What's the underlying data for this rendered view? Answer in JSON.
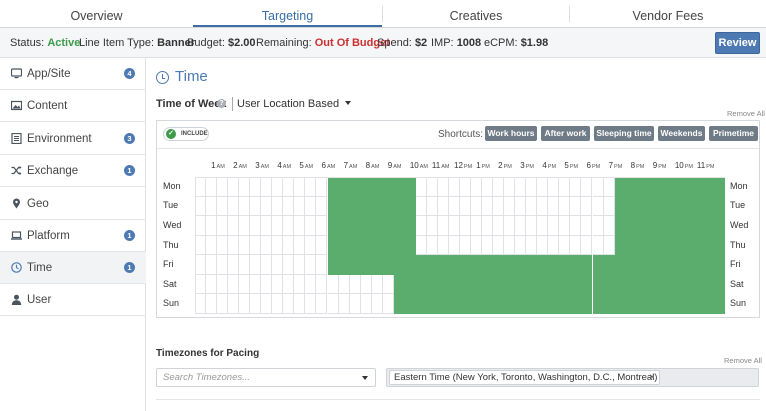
{
  "tabs": [
    {
      "label": "Overview",
      "active": false
    },
    {
      "label": "Targeting",
      "active": true
    },
    {
      "label": "Creatives",
      "active": false
    },
    {
      "label": "Vendor Fees",
      "active": false
    }
  ],
  "status": {
    "status_label": "Status:",
    "status_value": "Active",
    "type_label": "Line Item Type:",
    "type_value": "Banner",
    "budget_label": "Budget:",
    "budget_value": "$2.00",
    "remaining_label": "Remaining:",
    "remaining_value": "Out Of Budget",
    "spend_label": "Spend:",
    "spend_value": "$2",
    "imp_label": "IMP:",
    "imp_value": "1008",
    "ecpm_label": "eCPM:",
    "ecpm_value": "$1.98",
    "review_label": "Review",
    "colors": {
      "active": "#3c9a4a",
      "out_of_budget": "#cc2f2f",
      "accent": "#4d7ab2"
    }
  },
  "sidebar": {
    "items": [
      {
        "label": "App/Site",
        "badge": "4",
        "icon": "device-icon",
        "active": false
      },
      {
        "label": "Content",
        "badge": "",
        "icon": "image-icon",
        "active": false
      },
      {
        "label": "Environment",
        "badge": "3",
        "icon": "document-icon",
        "active": false
      },
      {
        "label": "Exchange",
        "badge": "1",
        "icon": "shuffle-icon",
        "active": false
      },
      {
        "label": "Geo",
        "badge": "",
        "icon": "map-pin-icon",
        "active": false
      },
      {
        "label": "Platform",
        "badge": "1",
        "icon": "laptop-icon",
        "active": false
      },
      {
        "label": "Time",
        "badge": "1",
        "icon": "clock-icon",
        "active": true
      },
      {
        "label": "User",
        "badge": "",
        "icon": "user-icon",
        "active": false
      }
    ]
  },
  "main": {
    "title": "Time",
    "time_of_week_label": "Time of Week",
    "targeting_mode": "User Location Based",
    "remove_all": "Remove All",
    "include_label": "INCLUDE",
    "shortcuts_label": "Shortcuts:",
    "shortcuts": [
      "Work hours",
      "After work",
      "Sleeping time",
      "Weekends",
      "Primetime"
    ],
    "hours": [
      {
        "n": "1",
        "p": "AM"
      },
      {
        "n": "2",
        "p": "AM"
      },
      {
        "n": "3",
        "p": "AM"
      },
      {
        "n": "4",
        "p": "AM"
      },
      {
        "n": "5",
        "p": "AM"
      },
      {
        "n": "6",
        "p": "AM"
      },
      {
        "n": "7",
        "p": "AM"
      },
      {
        "n": "8",
        "p": "AM"
      },
      {
        "n": "9",
        "p": "AM"
      },
      {
        "n": "10",
        "p": "AM"
      },
      {
        "n": "11",
        "p": "AM"
      },
      {
        "n": "12",
        "p": "PM"
      },
      {
        "n": "1",
        "p": "PM"
      },
      {
        "n": "2",
        "p": "PM"
      },
      {
        "n": "3",
        "p": "PM"
      },
      {
        "n": "4",
        "p": "PM"
      },
      {
        "n": "5",
        "p": "PM"
      },
      {
        "n": "6",
        "p": "PM"
      },
      {
        "n": "7",
        "p": "PM"
      },
      {
        "n": "8",
        "p": "PM"
      },
      {
        "n": "9",
        "p": "PM"
      },
      {
        "n": "10",
        "p": "PM"
      },
      {
        "n": "11",
        "p": "PM"
      }
    ],
    "days": [
      "Mon",
      "Tue",
      "Wed",
      "Thu",
      "Fri",
      "Sat",
      "Sun"
    ],
    "selected_ranges": [
      {
        "day": "Mon",
        "from_hour": 6,
        "to_hour": 10
      },
      {
        "day": "Mon",
        "from_hour": 19,
        "to_hour": 24
      },
      {
        "day": "Tue",
        "from_hour": 6,
        "to_hour": 10
      },
      {
        "day": "Tue",
        "from_hour": 19,
        "to_hour": 24
      },
      {
        "day": "Wed",
        "from_hour": 6,
        "to_hour": 10
      },
      {
        "day": "Wed",
        "from_hour": 19,
        "to_hour": 24
      },
      {
        "day": "Thu",
        "from_hour": 6,
        "to_hour": 10
      },
      {
        "day": "Thu",
        "from_hour": 19,
        "to_hour": 24
      },
      {
        "day": "Fri",
        "from_hour": 6,
        "to_hour": 24
      },
      {
        "day": "Sat",
        "from_hour": 9,
        "to_hour": 24
      },
      {
        "day": "Sun",
        "from_hour": 9,
        "to_hour": 24
      }
    ],
    "selection_color": "#5aad6c",
    "timezones_label": "Timezones for Pacing",
    "timezones_remove_all": "Remove All",
    "timezone_placeholder": "Search Timezones...",
    "selected_timezone": "Eastern Time (New York, Toronto, Washington, D.C., Montreal)",
    "remove_icon": "×"
  }
}
